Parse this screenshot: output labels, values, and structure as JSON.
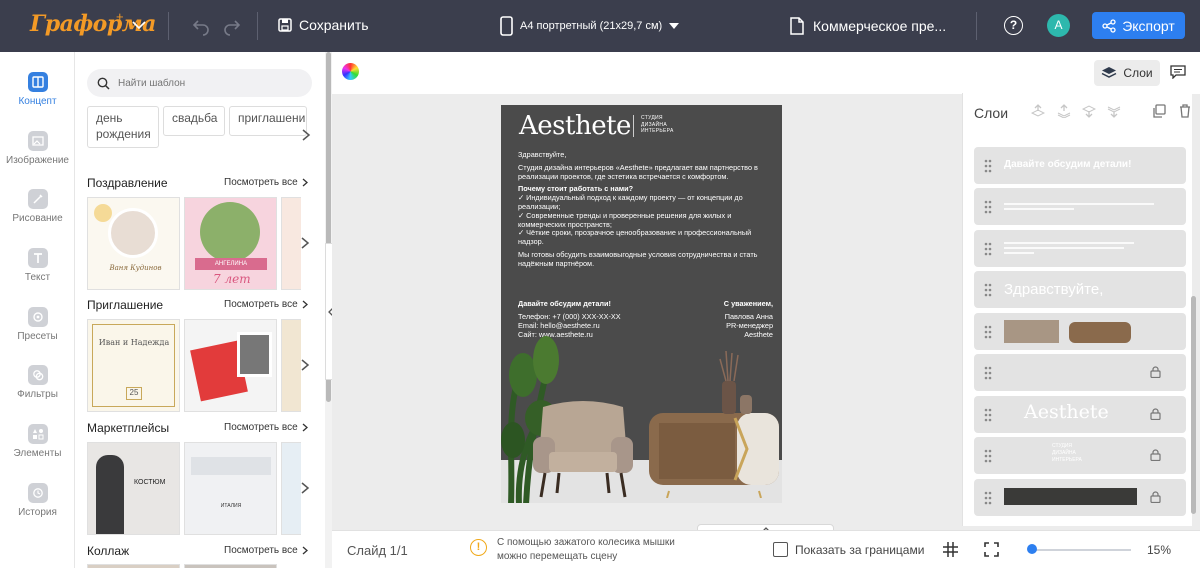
{
  "app": {
    "logo_text": "Граформа",
    "brand_color": "#f39a26"
  },
  "topbar": {
    "save_label": "Сохранить",
    "format_label": "А4 портретный (21х29,7 см)",
    "doc_title": "Коммерческое пре...",
    "help_label": "?",
    "avatar_letter": "A",
    "export_label": "Экспорт",
    "export_color": "#2d7ff0"
  },
  "rail": {
    "items": [
      {
        "label": "Концепт",
        "icon": "layout-icon",
        "active": true
      },
      {
        "label": "Изображение",
        "icon": "image-icon"
      },
      {
        "label": "Рисование",
        "icon": "brush-icon"
      },
      {
        "label": "Текст",
        "icon": "text-icon"
      },
      {
        "label": "Пресеты",
        "icon": "presets-icon"
      },
      {
        "label": "Фильтры",
        "icon": "filters-icon"
      },
      {
        "label": "Элементы",
        "icon": "elements-icon"
      },
      {
        "label": "История",
        "icon": "history-icon"
      }
    ]
  },
  "panel": {
    "search_placeholder": "Найти шаблон",
    "tags": [
      "день рождения",
      "свадьба",
      "приглашени"
    ],
    "see_all": "Посмотреть все",
    "sections": [
      {
        "title": "Поздравление",
        "thumbs": [
          "Ваня Кудинов",
          "АНГЕЛИНА",
          "7 лет"
        ]
      },
      {
        "title": "Приглашение",
        "thumbs": [
          "Иван и Надежда",
          "25"
        ]
      },
      {
        "title": "Маркетплейсы",
        "thumbs": [
          "КОСТЮМ",
          "ИТАЛИЯ"
        ]
      },
      {
        "title": "Коллаж",
        "thumbs": []
      }
    ]
  },
  "canvas": {
    "layers_button": "Слои",
    "document": {
      "logo": "Aesthete",
      "subtitle_lines": [
        "Студия",
        "дизайна",
        "интерьера"
      ],
      "greeting": "Здравствуйте,",
      "intro": "Студия дизайна интерьеров «Aesthete» предлагает вам партнерство в реализации проектов, где эстетика встречается с комфортом.",
      "why_title": "Почему стоит работать с нами?",
      "points": [
        "✓ Индивидуальный подход к каждому проекту — от концепции до реализации;",
        "✓ Современные тренды и проверенные решения для жилых и коммерческих пространств;",
        "✓ Чёткие сроки, прозрачное ценообразование и профессиональный надзор."
      ],
      "closing": "Мы готовы обсудить взаимовыгодные условия сотрудничества и стать надёжным партнёром.",
      "cta": "Давайте обсудим детали!",
      "phone": "Телефон: +7 (000) XXX-XX-XX",
      "email": "Email: hello@aesthete.ru",
      "site": "Сайт: www.aesthete.ru",
      "regards": "С уважением,",
      "signer": "Павлова Анна",
      "signer_role": "PR-менеджер",
      "signer_company": "Aesthete"
    }
  },
  "layers": {
    "title": "Слои",
    "items": [
      {
        "label": "Давайте обсудим детали!",
        "locked": false
      },
      {
        "label": "",
        "locked": false
      },
      {
        "label": "",
        "locked": false
      },
      {
        "label": "Здравствуйте,",
        "locked": false
      },
      {
        "label": "",
        "locked": false
      },
      {
        "label": "",
        "locked": true
      },
      {
        "label": "Aesthete",
        "locked": true
      },
      {
        "label": "Студия дизайна интерьера",
        "locked": true
      },
      {
        "label": "",
        "locked": true
      }
    ]
  },
  "bottombar": {
    "slide_label": "Слайд 1/1",
    "hint_line1": "С помощью зажатого колесика мышки",
    "hint_line2": "можно перемещать сцену",
    "show_outside": "Показать за границами",
    "zoom": "15%",
    "zoom_fraction": 0.02
  }
}
